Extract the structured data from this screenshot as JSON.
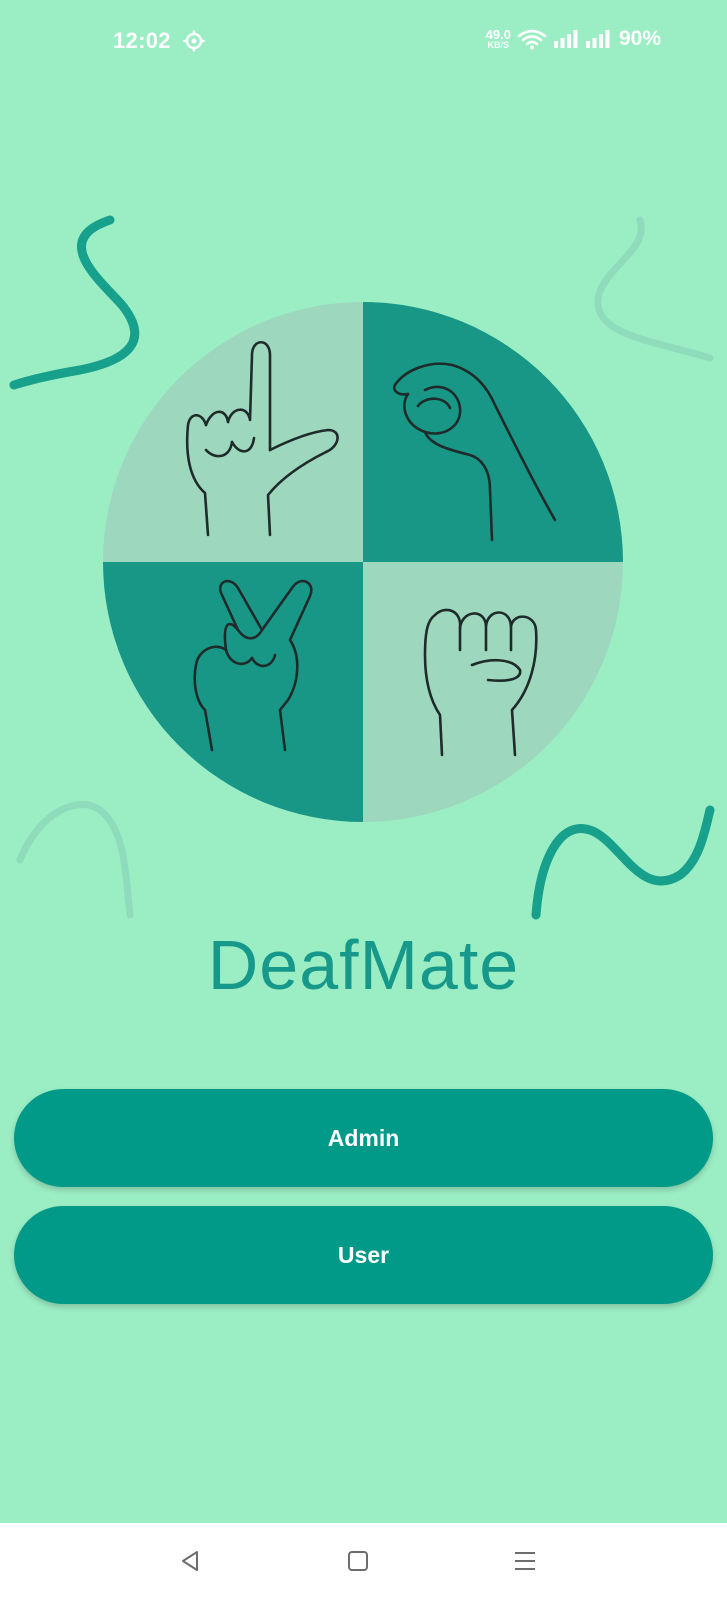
{
  "status_bar": {
    "time": "12:02",
    "net_speed_value": "49.0",
    "net_speed_unit": "KB/S",
    "battery": "90%",
    "icons": [
      "settings-gear-icon",
      "wifi-icon",
      "signal-bars-icon",
      "signal-bars-icon"
    ]
  },
  "app": {
    "title": "DeafMate"
  },
  "buttons": {
    "admin": "Admin",
    "user": "User"
  },
  "nav": {
    "icons": [
      "back-triangle-icon",
      "home-square-icon",
      "menu-lines-icon"
    ]
  },
  "colors": {
    "background": "#9bedc4",
    "primary": "#019a89",
    "title": "#16998a",
    "quadrant_light": "#9dd7bd",
    "quadrant_dark": "#189787"
  }
}
